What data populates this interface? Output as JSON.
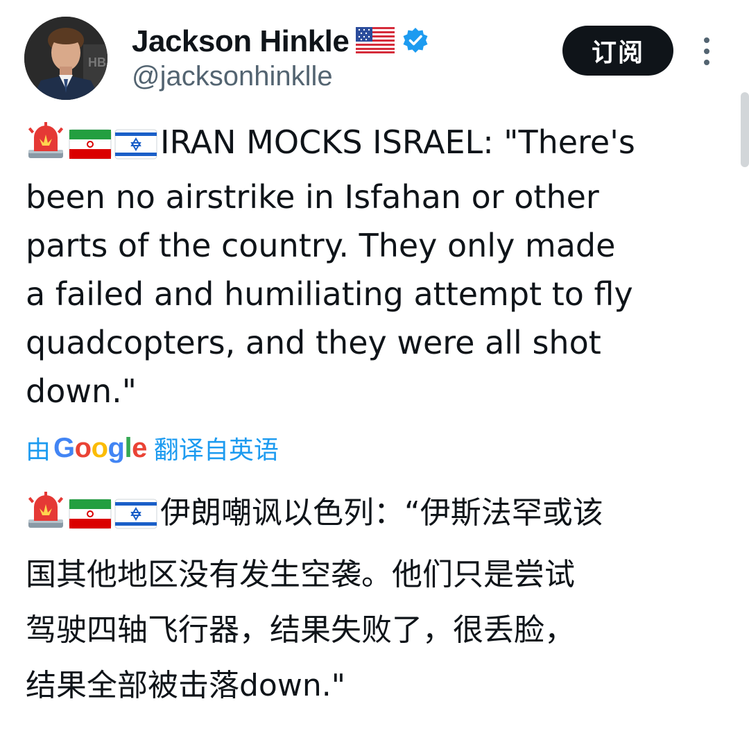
{
  "author": {
    "display_name": "Jackson Hinkle",
    "handle": "@jacksonhinklle",
    "avatar_icon": "profile-photo",
    "country_flag_icon": "us-flag-icon",
    "verified_icon": "verified-badge-icon",
    "verified_color": "#1d9bf0"
  },
  "header": {
    "subscribe_label": "订阅",
    "more_icon": "vertical-ellipsis-icon"
  },
  "tweet": {
    "emoji_icons": [
      "rotating-light-icon",
      "iran-flag-icon",
      "israel-flag-icon"
    ],
    "original_lines": [
      "IRAN MOCKS ISRAEL: \"There's",
      "been no airstrike in Isfahan or other",
      "parts of the country. They only made",
      "a failed and humiliating attempt to fly",
      "quadcopters, and they were all shot",
      "down.\""
    ],
    "translation_prefix": "由",
    "translation_brand": "Google",
    "translation_suffix": "翻译自英语",
    "translated_lines": [
      "伊朗嘲讽以色列：“伊斯法罕或该",
      "国其他地区没有发生空袭。他们只是尝试",
      "驾驶四轴飞行器，结果失败了，很丢脸，",
      "结果全部被击落down.\""
    ]
  },
  "colors": {
    "text_primary": "#0f1419",
    "text_secondary": "#536471",
    "link_blue": "#1d9bf0",
    "button_bg": "#0f1419"
  }
}
